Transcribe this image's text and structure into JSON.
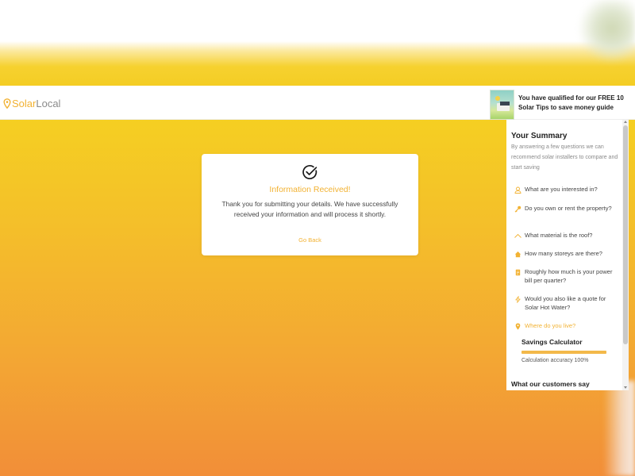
{
  "brand": {
    "name_part1": "Solar",
    "name_part2": "Local",
    "accent_color": "#f2b233"
  },
  "promo": {
    "text": "You have qualified for our FREE 10 Solar Tips to save money guide",
    "thumbnail_icon": "solar-guide-thumbnail"
  },
  "confirmation": {
    "icon": "check-circle-icon",
    "title": "Information Received!",
    "message": "Thank you for submitting your details. We have successfully received your information and will process it shortly.",
    "go_back_label": "Go Back"
  },
  "summary": {
    "title": "Your Summary",
    "description": "By answering a few questions we can recommend solar installers to compare and start saving",
    "questions": [
      {
        "icon": "person-icon",
        "label": "What are you interested in?"
      },
      {
        "icon": "key-icon",
        "label": "Do you own or rent the property?"
      },
      {
        "icon": "roof-icon",
        "label": "What material is the roof?"
      },
      {
        "icon": "house-icon",
        "label": "How many storeys are there?"
      },
      {
        "icon": "bill-icon",
        "label": "Roughly how much is your power bill per quarter?"
      },
      {
        "icon": "bolt-icon",
        "label": "Would you also like a quote for Solar Hot Water?"
      },
      {
        "icon": "location-pin-icon",
        "label": "Where do you live?",
        "active": true
      }
    ],
    "calculator": {
      "title": "Savings Calculator",
      "progress": 1.0,
      "accuracy_text": "Calculation accuracy 100%"
    },
    "customers_title": "What our customers say"
  }
}
